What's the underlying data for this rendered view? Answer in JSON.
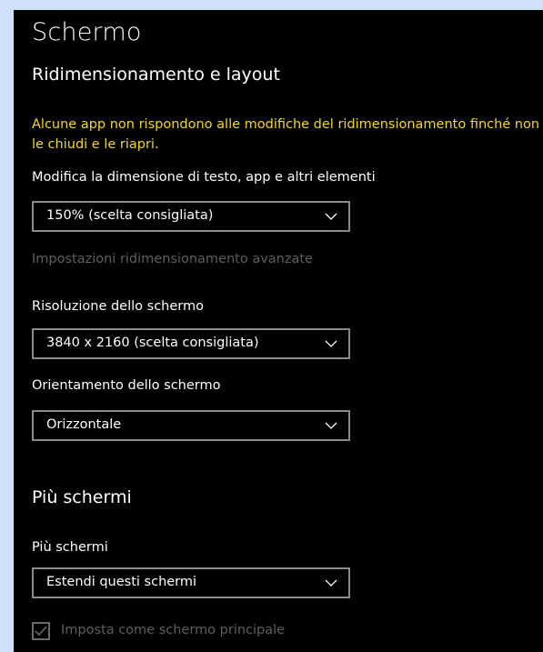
{
  "page": {
    "title": "Schermo"
  },
  "colors": {
    "background": "#000000",
    "text": "#ffffff",
    "warning": "#f3d62e",
    "disabled": "#5f5f5f",
    "dropdown_border": "#8a8a8a",
    "outer_frame": "#cfe0fb"
  },
  "scaling_section": {
    "title": "Ridimensionamento e layout",
    "warning_text": "Alcune app non rispondono alle modifiche del ridimensionamento finché non le chiudi e le riapri.",
    "size_label": "Modifica la dimensione di testo, app e altri elementi",
    "size_dropdown_value": "150% (scelta consigliata)",
    "advanced_link": "Impostazioni ridimensionamento avanzate",
    "resolution_label": "Risoluzione dello schermo",
    "resolution_dropdown_value": "3840 x 2160 (scelta consigliata)",
    "orientation_label": "Orientamento dello schermo",
    "orientation_dropdown_value": "Orizzontale"
  },
  "multi_display_section": {
    "title": "Più schermi",
    "label": "Più schermi",
    "dropdown_value": "Estendi questi schermi",
    "main_display_checkbox_label": "Imposta come schermo principale",
    "main_display_checked": true
  },
  "icons": {
    "dropdown_chevron": "chevron-down-icon",
    "checkmark": "checkmark-icon"
  }
}
